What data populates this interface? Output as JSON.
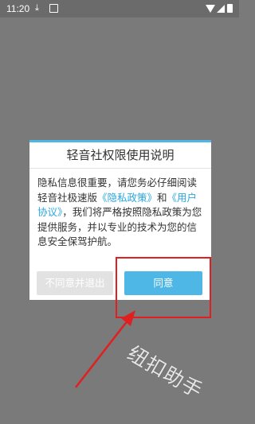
{
  "status_bar": {
    "time": "11:20",
    "icons": [
      "download-icon",
      "image-icon",
      "wifi-icon",
      "signal-icon",
      "battery-icon"
    ]
  },
  "dialog": {
    "title": "轻音社权限使用说明",
    "body_prefix": "隐私信息很重要，请您务必仔细阅读轻音社极速版",
    "privacy_link": "《隐私政策》",
    "and": "和",
    "user_link": "《用户协议》",
    "body_suffix": "，我们将严格按照隐私政策为您提供服务，并以专业的技术为您的信息安全保驾护航。",
    "cancel_label": "不同意并退出",
    "ok_label": "同意"
  },
  "watermark": "纽扣助手",
  "colors": {
    "accent": "#4fb7e6",
    "highlight": "#e02020",
    "overlay": "#7a7a7a"
  }
}
